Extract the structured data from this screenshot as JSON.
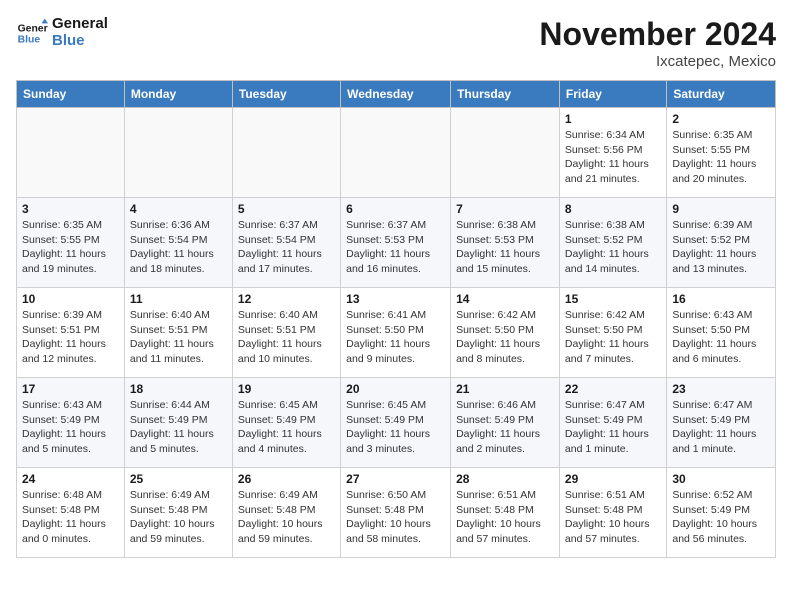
{
  "header": {
    "logo_line1": "General",
    "logo_line2": "Blue",
    "month_title": "November 2024",
    "location": "Ixcatepec, Mexico"
  },
  "weekdays": [
    "Sunday",
    "Monday",
    "Tuesday",
    "Wednesday",
    "Thursday",
    "Friday",
    "Saturday"
  ],
  "weeks": [
    [
      {
        "day": "",
        "info": ""
      },
      {
        "day": "",
        "info": ""
      },
      {
        "day": "",
        "info": ""
      },
      {
        "day": "",
        "info": ""
      },
      {
        "day": "",
        "info": ""
      },
      {
        "day": "1",
        "info": "Sunrise: 6:34 AM\nSunset: 5:56 PM\nDaylight: 11 hours and 21 minutes."
      },
      {
        "day": "2",
        "info": "Sunrise: 6:35 AM\nSunset: 5:55 PM\nDaylight: 11 hours and 20 minutes."
      }
    ],
    [
      {
        "day": "3",
        "info": "Sunrise: 6:35 AM\nSunset: 5:55 PM\nDaylight: 11 hours and 19 minutes."
      },
      {
        "day": "4",
        "info": "Sunrise: 6:36 AM\nSunset: 5:54 PM\nDaylight: 11 hours and 18 minutes."
      },
      {
        "day": "5",
        "info": "Sunrise: 6:37 AM\nSunset: 5:54 PM\nDaylight: 11 hours and 17 minutes."
      },
      {
        "day": "6",
        "info": "Sunrise: 6:37 AM\nSunset: 5:53 PM\nDaylight: 11 hours and 16 minutes."
      },
      {
        "day": "7",
        "info": "Sunrise: 6:38 AM\nSunset: 5:53 PM\nDaylight: 11 hours and 15 minutes."
      },
      {
        "day": "8",
        "info": "Sunrise: 6:38 AM\nSunset: 5:52 PM\nDaylight: 11 hours and 14 minutes."
      },
      {
        "day": "9",
        "info": "Sunrise: 6:39 AM\nSunset: 5:52 PM\nDaylight: 11 hours and 13 minutes."
      }
    ],
    [
      {
        "day": "10",
        "info": "Sunrise: 6:39 AM\nSunset: 5:51 PM\nDaylight: 11 hours and 12 minutes."
      },
      {
        "day": "11",
        "info": "Sunrise: 6:40 AM\nSunset: 5:51 PM\nDaylight: 11 hours and 11 minutes."
      },
      {
        "day": "12",
        "info": "Sunrise: 6:40 AM\nSunset: 5:51 PM\nDaylight: 11 hours and 10 minutes."
      },
      {
        "day": "13",
        "info": "Sunrise: 6:41 AM\nSunset: 5:50 PM\nDaylight: 11 hours and 9 minutes."
      },
      {
        "day": "14",
        "info": "Sunrise: 6:42 AM\nSunset: 5:50 PM\nDaylight: 11 hours and 8 minutes."
      },
      {
        "day": "15",
        "info": "Sunrise: 6:42 AM\nSunset: 5:50 PM\nDaylight: 11 hours and 7 minutes."
      },
      {
        "day": "16",
        "info": "Sunrise: 6:43 AM\nSunset: 5:50 PM\nDaylight: 11 hours and 6 minutes."
      }
    ],
    [
      {
        "day": "17",
        "info": "Sunrise: 6:43 AM\nSunset: 5:49 PM\nDaylight: 11 hours and 5 minutes."
      },
      {
        "day": "18",
        "info": "Sunrise: 6:44 AM\nSunset: 5:49 PM\nDaylight: 11 hours and 5 minutes."
      },
      {
        "day": "19",
        "info": "Sunrise: 6:45 AM\nSunset: 5:49 PM\nDaylight: 11 hours and 4 minutes."
      },
      {
        "day": "20",
        "info": "Sunrise: 6:45 AM\nSunset: 5:49 PM\nDaylight: 11 hours and 3 minutes."
      },
      {
        "day": "21",
        "info": "Sunrise: 6:46 AM\nSunset: 5:49 PM\nDaylight: 11 hours and 2 minutes."
      },
      {
        "day": "22",
        "info": "Sunrise: 6:47 AM\nSunset: 5:49 PM\nDaylight: 11 hours and 1 minute."
      },
      {
        "day": "23",
        "info": "Sunrise: 6:47 AM\nSunset: 5:49 PM\nDaylight: 11 hours and 1 minute."
      }
    ],
    [
      {
        "day": "24",
        "info": "Sunrise: 6:48 AM\nSunset: 5:48 PM\nDaylight: 11 hours and 0 minutes."
      },
      {
        "day": "25",
        "info": "Sunrise: 6:49 AM\nSunset: 5:48 PM\nDaylight: 10 hours and 59 minutes."
      },
      {
        "day": "26",
        "info": "Sunrise: 6:49 AM\nSunset: 5:48 PM\nDaylight: 10 hours and 59 minutes."
      },
      {
        "day": "27",
        "info": "Sunrise: 6:50 AM\nSunset: 5:48 PM\nDaylight: 10 hours and 58 minutes."
      },
      {
        "day": "28",
        "info": "Sunrise: 6:51 AM\nSunset: 5:48 PM\nDaylight: 10 hours and 57 minutes."
      },
      {
        "day": "29",
        "info": "Sunrise: 6:51 AM\nSunset: 5:48 PM\nDaylight: 10 hours and 57 minutes."
      },
      {
        "day": "30",
        "info": "Sunrise: 6:52 AM\nSunset: 5:49 PM\nDaylight: 10 hours and 56 minutes."
      }
    ]
  ]
}
